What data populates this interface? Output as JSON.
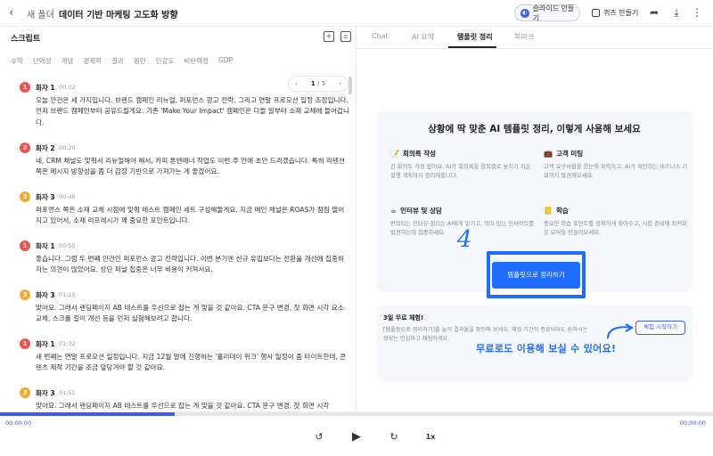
{
  "header": {
    "back_icon": "chevron-left-icon",
    "crumb_folder": "새 폴더",
    "crumb_sep": "/",
    "title": "데이터 기반 마케팅 고도화 방향",
    "slide_button": "슬라이드 만들기",
    "quiz_button": "퀴즈 만들기",
    "share_icon": "share-icon",
    "download_icon": "download-icon",
    "more_icon": "more-vertical-icon"
  },
  "script": {
    "title": "스크립트",
    "keywords": [
      "수익",
      "단역성",
      "개념",
      "경제학",
      "결과",
      "원인",
      "민감도",
      "비탄력성",
      "GDP"
    ],
    "pager": {
      "current": "1",
      "total": "/ 3"
    },
    "entries": [
      {
        "n": "1",
        "color": "#ef5350",
        "speaker": "화자 1",
        "time": "00:02",
        "text": "오늘 안건은 세 가지입니다. 브랜드 캠페인 리뉴얼, 퍼포먼스 광고 전략, 그리고 연말 프로모션 일정 조정입니다. 먼저 브랜드 캠페인부터 공유드릴게요. 기존 'Make Your Impact' 캠페인은 다들 알부터 소재 교체에 들어갑니다."
      },
      {
        "n": "2",
        "color": "#ef5350",
        "speaker": "화자 2",
        "time": "00:20",
        "text": "네, CRM 채널도 맞춰서 리뉴얼해야 해서, 카피 톤앤매너 작업도 이번 주 안에 초안 드리겠습니다. 특히 리텐션 쪽은 메시지 방향성을 좀 더 감정 기반으로 가져가는 게 좋겠어요."
      },
      {
        "n": "3",
        "color": "#f9a825",
        "speaker": "화자 3",
        "time": "00:46",
        "text": "퍼포먼스 쪽은 소재 교체 시점에 맞춰 테스트 캠페인 세트 구성해둘게요. 지금 메인 채널은 ROAS가 점점 떨어지고 있어서, 소재 리프레시가 꽤 중요한 포인트입니다."
      },
      {
        "n": "1",
        "color": "#ef5350",
        "speaker": "화자 1",
        "time": "00:55",
        "text": "좋습니다. 그럼 두 번째 안건인 퍼포먼스 광고 전략입니다. 이번 분기엔 신규 유입보다는 전환율 개선에 집중하자는 의견이 많았어요. 상단 퍼널 집중은 너무 비용이 커져서요."
      },
      {
        "n": "3",
        "color": "#f9a825",
        "speaker": "화자 3",
        "time": "01:15",
        "text": "맞아요. 그래서 랜딩페이지 AB 테스트를 우선으로 잡는 게 맞을 것 같아요. CTA 문구 변경, 첫 화면 시각 요소 교체, 스크롤 길이 개선 등을 먼저 실험해보려고 합니다."
      },
      {
        "n": "1",
        "color": "#ef5350",
        "speaker": "화자 1",
        "time": "01:32",
        "text": "세 번째는 연말 프로모션 일정입니다. 지금 12월 말에 진행하는 '홀리데이 위크' 행사 일정이 좀 타이트한데, 콘텐츠 제작 기간을 조금 앞당겨야 할 것 같아요."
      },
      {
        "n": "3",
        "color": "#f9a825",
        "speaker": "화자 3",
        "time": "01:51",
        "text": "맞아요. 그래서 랜딩페이지 AB 테스트를 우선으로 잡는 게 맞을 것 같아요. CTA 문구 변경, 첫 화면 시각"
      }
    ]
  },
  "player": {
    "time_current": "00:00:00",
    "time_total": "00:00:00",
    "progress": 0.245,
    "rewind_icon": "rewind-icon",
    "play_icon": "play-icon",
    "forward_icon": "fast-forward-icon",
    "speed": "1x"
  },
  "tabs": [
    "Chat",
    "AI 요약",
    "템플릿 정리",
    "북마크"
  ],
  "template_card": {
    "title": "상황에 딱 맞춘 AI 템플릿 정리, 이렇게 사용해 보세요",
    "features": [
      {
        "icon": "📝",
        "title": "회의록 작성",
        "desc": "긴 회의도 걱정 없어요. AI가 회의록을 항목별로 놓치기 쉬운 실행 계획까지 정리해줍니다."
      },
      {
        "icon": "💼",
        "title": "고객 미팅",
        "desc": "고객 요구사항을 한눈에 파악하고, AI가 제안하는 비즈니스 기회까지 발견해보세요."
      },
      {
        "icon": "☕",
        "title": "인터뷰 및 상담",
        "desc": "번복되는 인터뷰 정리는 AI에게 맡기고, 의미 있는 인사이트를 발견하는데 집중하세요."
      },
      {
        "icon": "📒",
        "title": "학습",
        "desc": "중요한 학습 포인트를 정확하게 찾아주고, 시험 준비에 최적화된 요약을 만들어보세요."
      }
    ],
    "cta": "템플릿으로 정리하기"
  },
  "trial": {
    "title": "3일 무료 체험!",
    "desc": "[템플릿으로 정리하기]를 눌러 결과물을 확인해 보세요. 체험 기간이 종료되어도 원하시는 정보는 안심하고 체험하세요.",
    "button": "체험 시작하기"
  },
  "annotation": {
    "number": "4",
    "note": "무료로도 이용해 보실 수 있어요!",
    "arrow_icon": "curved-arrow-icon"
  }
}
